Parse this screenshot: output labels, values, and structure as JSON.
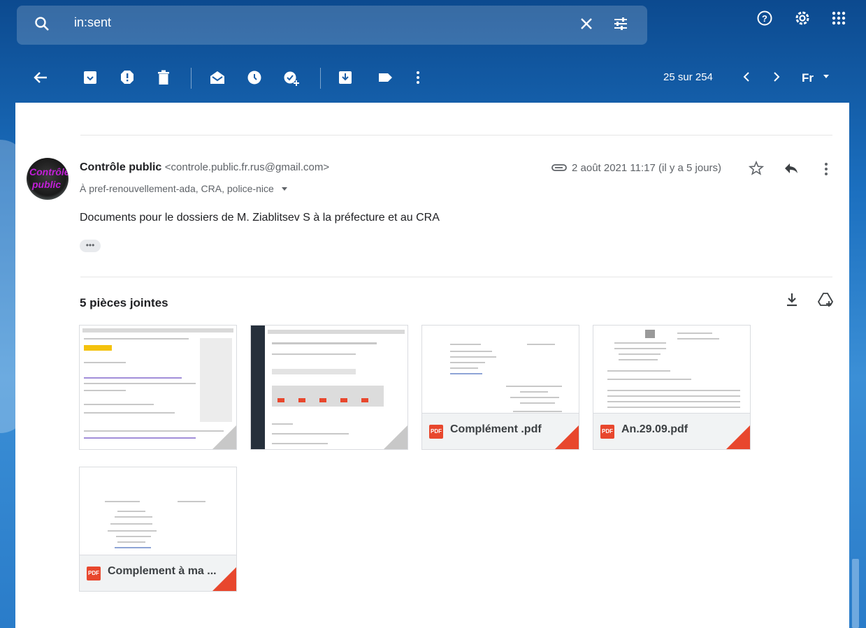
{
  "search": {
    "query": "in:sent"
  },
  "toolbar": {
    "counter": "25 sur 254",
    "language": "Fr"
  },
  "message": {
    "sender_name": "Contrôle public",
    "sender_email": "<controle.public.fr.rus@gmail.com>",
    "recipients": "À pref-renouvellement-ada, CRA, police-nice",
    "date": "2 août 2021 11:17 (il y a 5 jours)",
    "body": "Documents pour le dossiers de M. Ziablitsev S à la préfecture et au CRA",
    "avatar_text_1": "Contrôle",
    "avatar_text_2": "public",
    "show_trimmed": "•••"
  },
  "attachments": {
    "title": "5 pièces jointes",
    "items": [
      {
        "name": "",
        "type": "image"
      },
      {
        "name": "",
        "type": "image"
      },
      {
        "name": "Complément .pdf",
        "type": "pdf"
      },
      {
        "name": "An.29.09.pdf",
        "type": "pdf"
      },
      {
        "name": "Complement à ma ...",
        "type": "pdf"
      }
    ],
    "pdf_badge": "PDF"
  },
  "colors": {
    "accent": "#1a73e8",
    "pdf_red": "#e8472d"
  }
}
